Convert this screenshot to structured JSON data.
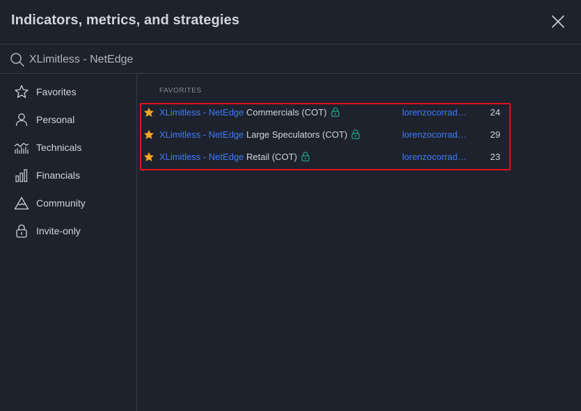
{
  "dialog": {
    "title": "Indicators, metrics, and strategies"
  },
  "search": {
    "value": "XLimitless - NetEdge",
    "placeholder": "Search"
  },
  "sidebar": {
    "items": [
      {
        "label": "Favorites",
        "icon": "star-outline-icon"
      },
      {
        "label": "Personal",
        "icon": "person-icon"
      },
      {
        "label": "Technicals",
        "icon": "technicals-chart-icon"
      },
      {
        "label": "Financials",
        "icon": "bar-chart-icon"
      },
      {
        "label": "Community",
        "icon": "mountain-icon"
      },
      {
        "label": "Invite-only",
        "icon": "lock-icon"
      }
    ]
  },
  "main": {
    "section_title": "FAVORITES",
    "rows": [
      {
        "prefix": "XLimitless - NetEdge",
        "name": " Commercials (COT)",
        "author": "lorenzocorrad…",
        "count": "24"
      },
      {
        "prefix": "XLimitless - NetEdge",
        "name": " Large Speculators (COT)",
        "author": "lorenzocorrad…",
        "count": "29"
      },
      {
        "prefix": "XLimitless - NetEdge",
        "name": " Retail (COT)",
        "author": "lorenzocorrad…",
        "count": "23"
      }
    ]
  },
  "colors": {
    "background": "#1e222d",
    "link": "#3d7cf5",
    "star": "#f5a623",
    "lock": "#22ab94",
    "highlight": "#e0141e"
  }
}
